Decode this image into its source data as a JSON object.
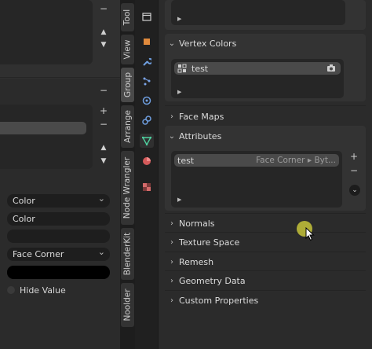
{
  "left_panel": {
    "buttons": {
      "plus": "+",
      "minus": "−",
      "up": "▲",
      "down": "▼"
    },
    "fields": [
      {
        "label": "Color",
        "type": "dropdown"
      },
      {
        "label": "Color",
        "type": "text"
      },
      {
        "label": "",
        "type": "empty"
      },
      {
        "label": "Face Corner",
        "type": "dropdown"
      },
      {
        "label": "",
        "type": "color-swatch"
      }
    ],
    "checkbox_label": "Hide Value"
  },
  "tabs": [
    "Tool",
    "View",
    "Group",
    "Arrange",
    "Node Wrangler",
    "BlenderKit",
    "Noolder"
  ],
  "active_tab": "Group",
  "properties": {
    "vertex_colors": {
      "title": "Vertex Colors",
      "item": "test"
    },
    "face_maps": {
      "title": "Face Maps"
    },
    "attributes": {
      "title": "Attributes",
      "item_name": "test",
      "item_domain": "Face Corner ▸ Byt..."
    },
    "collapsed_panels": [
      "Normals",
      "Texture Space",
      "Remesh",
      "Geometry Data",
      "Custom Properties"
    ]
  },
  "colors": {
    "accent_blue": "#4772b3",
    "cursor_highlight": "#c5c33a",
    "background": "#2b2b2b"
  }
}
